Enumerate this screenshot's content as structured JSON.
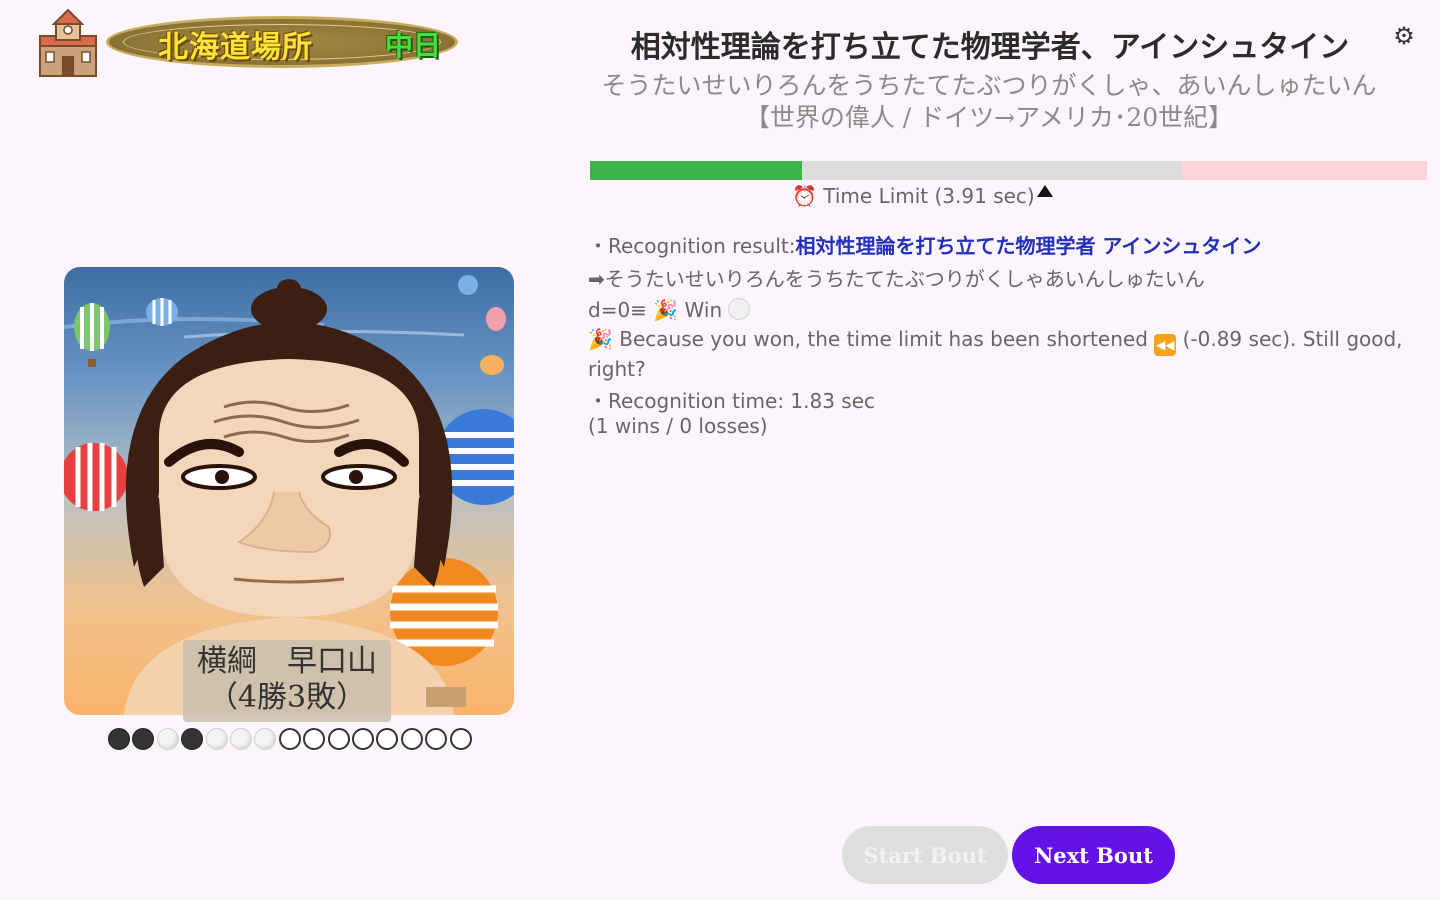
{
  "header": {
    "stable_name": "北海道場所",
    "sponsor": "中日",
    "settings_icon": "gear-icon"
  },
  "question": {
    "title": "相対性理論を打ち立てた物理学者、アインシュタイン",
    "reading": "そうたいせいりろんをうちたてたぶつりがくしゃ、あいんしゅたいん【世界の偉人 / ドイツ→アメリカ･20世紀】"
  },
  "timer": {
    "label": "⏰ Time Limit (3.91 sec)",
    "green_fraction": 0.253,
    "grey_fraction": 0.454,
    "pink_fraction": 0.293
  },
  "result": {
    "recognition_prefix": "・Recognition result:",
    "recognition_text": "相対性理論を打ち立てた物理学者 アインシュタイン",
    "reading_line": "➡そうたいせいりろんをうちたてたぶつりがくしゃあいんしゅたいん",
    "distance_line": "d=0≡ 🎉 Win",
    "shortened_before": "🎉 Because you won, the time limit has been shortened",
    "shortened_after": "(-0.89 sec). Still good, right?",
    "recognition_time": "・Recognition time: 1.83 sec",
    "record": "(1 wins / 0 losses)"
  },
  "opponent": {
    "rank_name": "横綱　早口山",
    "record": "（4勝3敗）"
  },
  "bouts": [
    "loss",
    "loss",
    "win",
    "loss",
    "win",
    "win",
    "win",
    "open",
    "open",
    "open",
    "open",
    "open",
    "open",
    "open",
    "open"
  ],
  "buttons": {
    "start": "Start Bout",
    "next": "Next Bout"
  },
  "colors": {
    "accent": "#6312e8",
    "timer_green": "#3bb54a",
    "timer_grey": "#dcdcdc",
    "timer_pink": "#ffd2d7",
    "recognition_text": "#2230b6"
  }
}
